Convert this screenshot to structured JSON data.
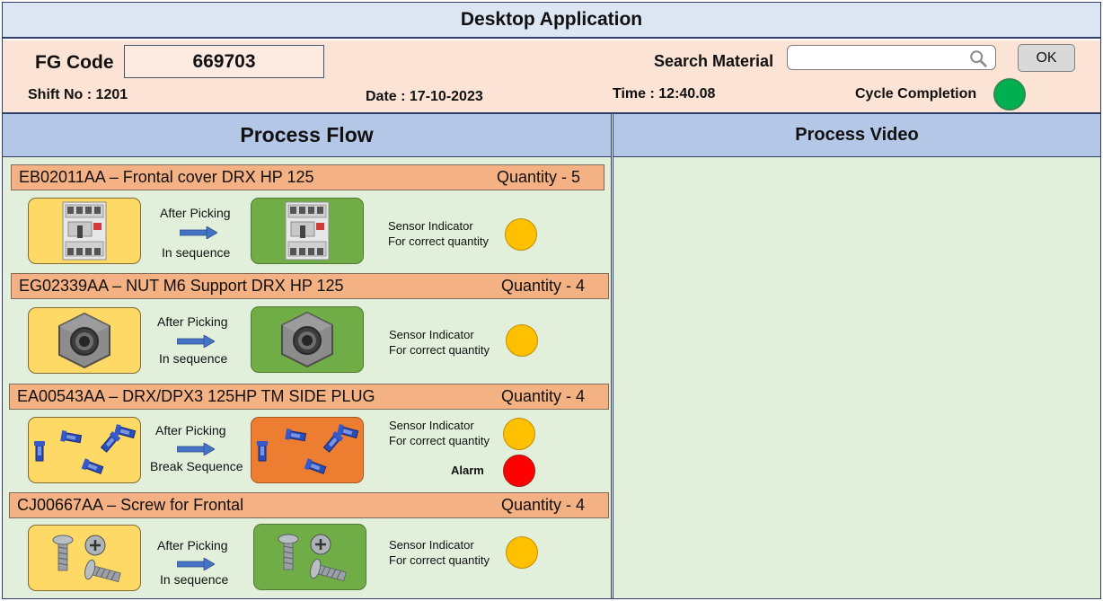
{
  "app": {
    "title": "Desktop Application"
  },
  "header": {
    "fg_code_label": "FG Code",
    "fg_code_value": "669703",
    "search_label": "Search Material",
    "search_value": "",
    "search_placeholder": "",
    "ok_label": "OK",
    "shift_text": "Shift No  :  1201",
    "date_text": "Date : 17-10-2023",
    "time_text": "Time :  12:40.08",
    "cycle_label": "Cycle Completion",
    "cycle_status_color": "#00b050"
  },
  "panels": {
    "process_flow_title": "Process Flow",
    "process_video_title": "Process Video"
  },
  "materials": [
    {
      "code_desc": "EB02011AA – Frontal cover  DRX HP 125",
      "quantity": "Quantity - 5",
      "before_icon": "circuit-breaker-icon",
      "after_icon": "circuit-breaker-icon",
      "after_bg": "#70ad47",
      "flow_top": "After Picking",
      "flow_bottom": "In sequence",
      "sensor_line1": "Sensor Indicator",
      "sensor_line2": "For correct quantity",
      "sensor_color": "#ffc000"
    },
    {
      "code_desc": "EG02339AA – NUT M6 Support  DRX HP 125",
      "quantity": "Quantity - 4",
      "before_icon": "hex-nut-icon",
      "after_icon": "hex-nut-icon",
      "after_bg": "#70ad47",
      "flow_top": "After Picking",
      "flow_bottom": "In sequence",
      "sensor_line1": "Sensor Indicator",
      "sensor_line2": "For correct quantity",
      "sensor_color": "#ffc000"
    },
    {
      "code_desc": "EA00543AA – DRX/DPX3 125HP TM SIDE PLUG",
      "quantity": "Quantity - 4",
      "before_icon": "side-plug-icon",
      "after_icon": "side-plug-icon",
      "after_bg": "#ed7d31",
      "flow_top": "After Picking",
      "flow_bottom": "Break Sequence",
      "sensor_line1": "Sensor Indicator",
      "sensor_line2": "For correct quantity",
      "sensor_color": "#ffc000",
      "alarm_label": "Alarm",
      "alarm_color": "#ff0000"
    },
    {
      "code_desc": "CJ00667AA – Screw  for Frontal",
      "quantity": "Quantity - 4",
      "before_icon": "screw-icon",
      "after_icon": "screw-icon",
      "after_bg": "#70ad47",
      "flow_top": "After Picking",
      "flow_bottom": "In sequence",
      "sensor_line1": "Sensor Indicator",
      "sensor_line2": "For correct quantity",
      "sensor_color": "#ffc000"
    }
  ]
}
